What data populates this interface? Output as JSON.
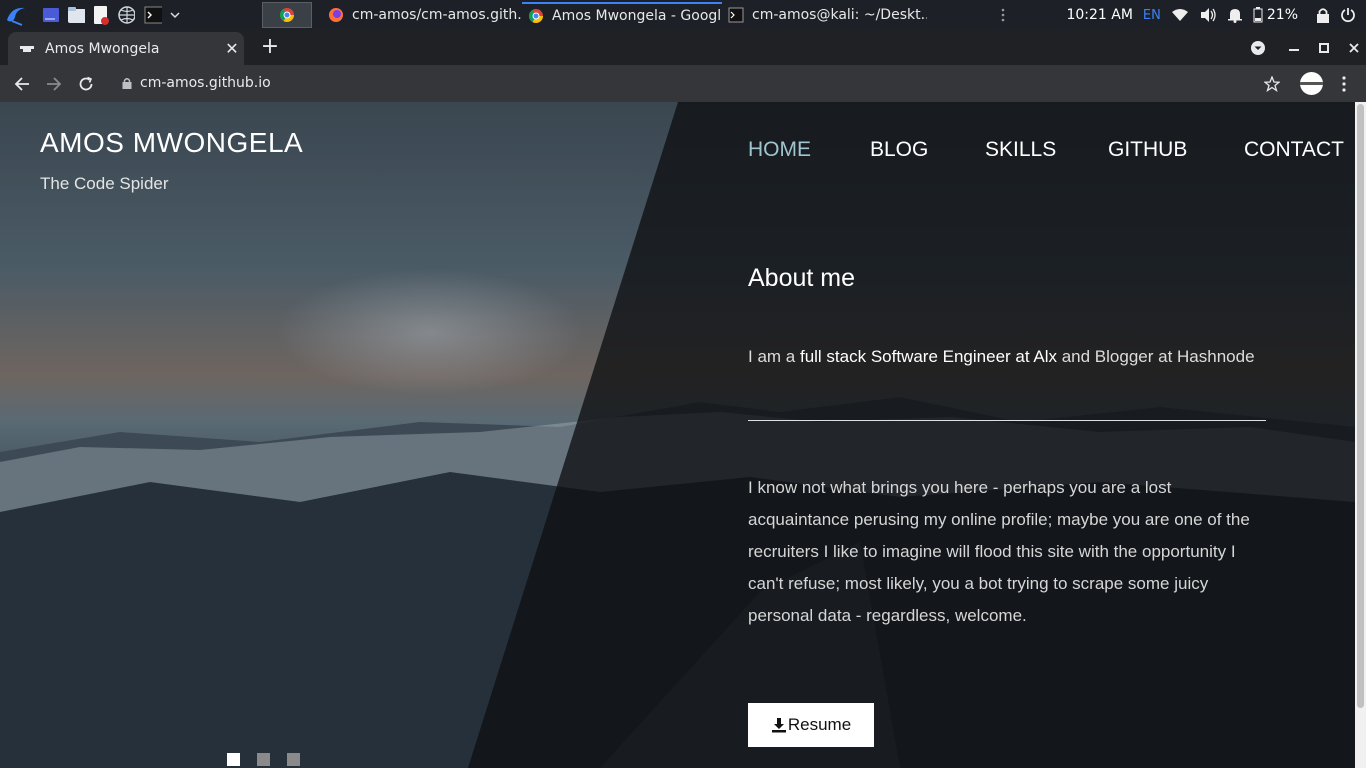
{
  "taskbar": {
    "apps": [
      {
        "label": ""
      },
      {
        "label": "cm-amos/cm-amos.gith..."
      },
      {
        "label": "Amos Mwongela - Googl..."
      },
      {
        "label": "cm-amos@kali: ~/Deskt..."
      }
    ],
    "clock": "10:21 AM",
    "keyboard_layout": "EN",
    "battery": "21%"
  },
  "browser": {
    "tab_title": "Amos Mwongela",
    "url": "cm-amos.github.io"
  },
  "site": {
    "brand": "AMOS MWONGELA",
    "tagline": "The Code Spider",
    "nav": [
      "HOME",
      "BLOG",
      "SKILLS",
      "GITHUB",
      "CONTACT"
    ],
    "active_nav": "HOME",
    "about_title": "About me",
    "intro_prefix": "I am a ",
    "intro_bold": "full stack Software Engineer at Alx",
    "intro_suffix": " and Blogger at Hashnode",
    "paragraph": "I know not what brings you here - perhaps you are a lost acquaintance perusing my online profile; maybe you are one of the recruiters I like to imagine will flood this site with the opportunity I can't refuse; most likely, you a bot trying to scrape some juicy personal data - regardless, welcome.",
    "resume_label": "Resume",
    "slider_active_index": 1,
    "slider_count": 3
  },
  "icons": {
    "taskbar": [
      "kali-menu-icon",
      "workspace-icon",
      "files-icon",
      "text-editor-icon",
      "browser-icon",
      "terminal-icon",
      "chevron-down-icon"
    ],
    "tray": [
      "more-vertical-icon",
      "wifi-icon",
      "volume-icon",
      "bell-icon",
      "battery-icon",
      "lock-icon",
      "power-icon"
    ]
  },
  "colors": {
    "active_nav": "#9fc5cf",
    "chrome_dark": "#202124",
    "chrome_tab": "#35363a"
  }
}
